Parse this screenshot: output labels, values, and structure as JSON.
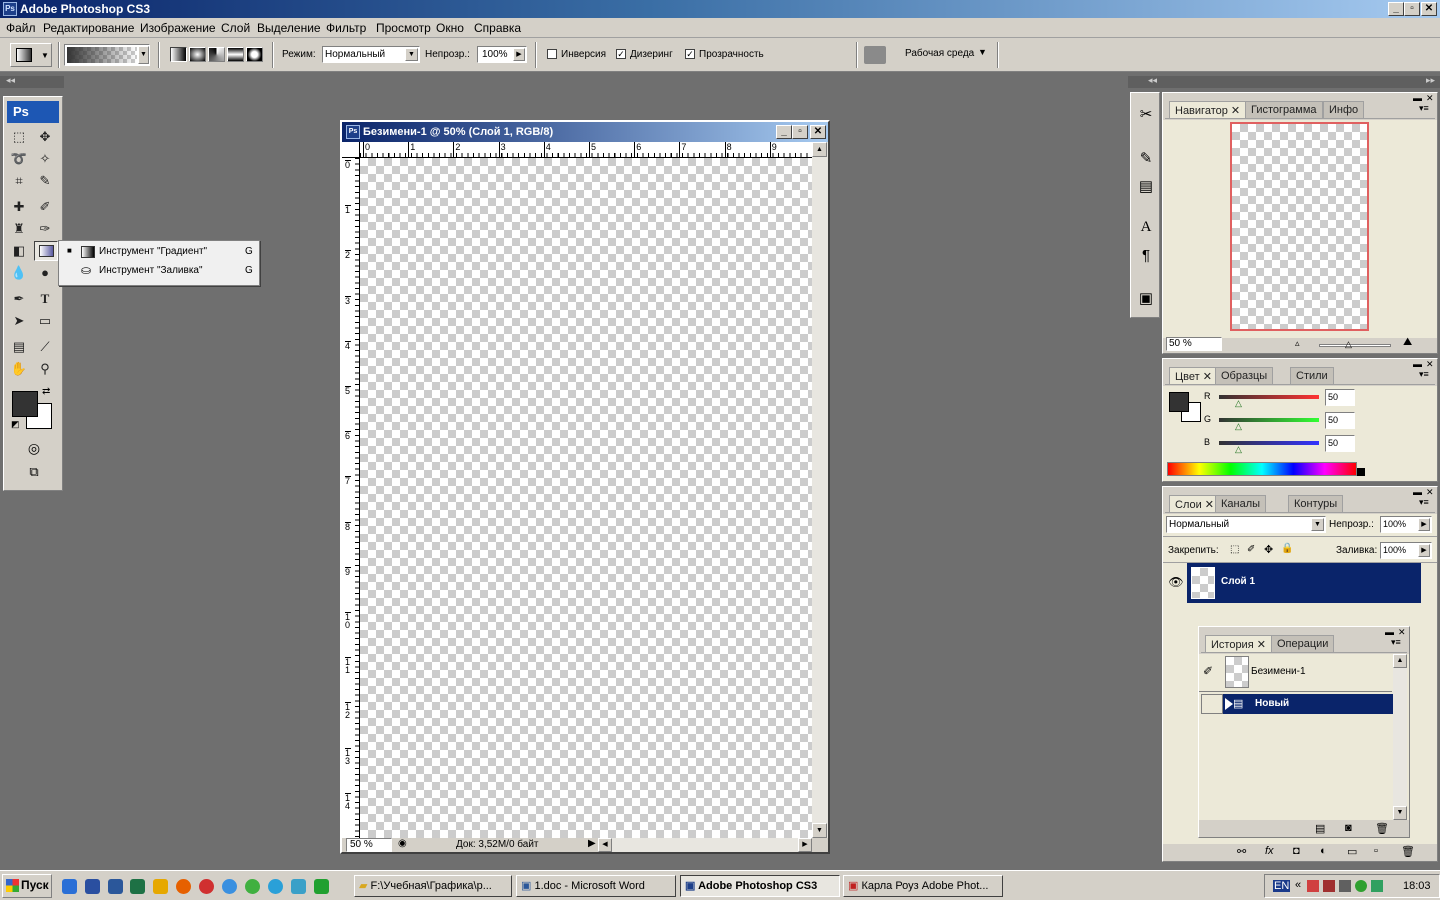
{
  "app": {
    "title": "Adobe Photoshop CS3",
    "ps_logo": "Ps"
  },
  "menu": [
    "Файл",
    "Редактирование",
    "Изображение",
    "Слой",
    "Выделение",
    "Фильтр",
    "Просмотр",
    "Окно",
    "Справка"
  ],
  "options": {
    "mode_label": "Режим:",
    "mode_value": "Нормальный",
    "opacity_label": "Непрозр.:",
    "opacity_value": "100%",
    "reverse_label": "Инверсия",
    "reverse_checked": false,
    "dither_label": "Дизеринг",
    "dither_checked": true,
    "transparency_label": "Прозрачность",
    "transparency_checked": true,
    "workspace_label": "Рабочая среда"
  },
  "flyout": {
    "items": [
      {
        "label": "Инструмент \"Градиент\"",
        "shortcut": "G",
        "selected": true
      },
      {
        "label": "Инструмент \"Заливка\"",
        "shortcut": "G",
        "selected": false
      }
    ]
  },
  "document": {
    "title": "Безимени-1 @ 50% (Слой 1, RGB/8)",
    "zoom": "50 %",
    "status": "Док: 3,52M/0 байт",
    "ruler_h": [
      "0",
      "1",
      "2",
      "3",
      "4",
      "5",
      "6",
      "7",
      "8",
      "9"
    ],
    "ruler_v": [
      "0",
      "1",
      "2",
      "3",
      "4",
      "5",
      "6",
      "7",
      "8",
      "9",
      "10",
      "11",
      "12",
      "13",
      "14"
    ]
  },
  "navigator": {
    "tabs": [
      "Навигатор",
      "Гистограмма",
      "Инфо"
    ],
    "zoom": "50 %"
  },
  "color": {
    "tabs": [
      "Цвет",
      "Образцы",
      "Стили"
    ],
    "r_label": "R",
    "r_value": "50",
    "g_label": "G",
    "g_value": "50",
    "b_label": "B",
    "b_value": "50"
  },
  "layers": {
    "tabs": [
      "Слои",
      "Каналы",
      "Контуры"
    ],
    "blend": "Нормальный",
    "opacity_label": "Непрозр.:",
    "opacity_value": "100%",
    "lock_label": "Закрепить:",
    "fill_label": "Заливка:",
    "fill_value": "100%",
    "layer_name": "Слой 1"
  },
  "history": {
    "tabs": [
      "История",
      "Операции"
    ],
    "snapshot": "Безимени-1",
    "step": "Новый"
  },
  "taskbar": {
    "start": "Пуск",
    "tasks": [
      {
        "label": "F:\\Учебная\\Графика\\р...",
        "active": false
      },
      {
        "label": "1.doc - Microsoft Word",
        "active": false
      },
      {
        "label": "Adobe Photoshop CS3",
        "active": true
      },
      {
        "label": "Карла Роуз Adobe Phot...",
        "active": false
      }
    ],
    "lang": "EN",
    "clock": "18:03"
  },
  "colors": {
    "title_start": "#0a246a",
    "title_end": "#a6caf0",
    "selection": "#0a246a",
    "workspace": "#6f6f6f",
    "nav_frame": "#e06060"
  }
}
